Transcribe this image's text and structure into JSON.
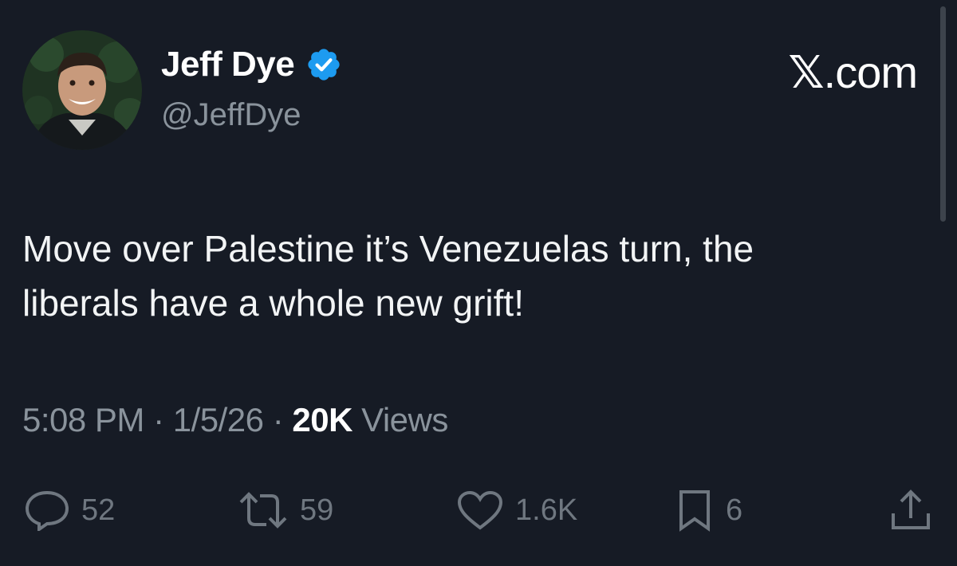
{
  "author": {
    "name": "Jeff Dye",
    "handle": "@JeffDye",
    "verified": true
  },
  "brand": {
    "domain": ".com",
    "logo_glyph": "𝕏"
  },
  "tweet": {
    "text_line1": "Move over Palestine it’s Venezuelas turn, the",
    "text_line2": "liberals have a whole new grift!"
  },
  "meta": {
    "time": "5:08 PM",
    "separator1": " · ",
    "date": "1/5/26",
    "separator2": " · ",
    "views_count": "20K",
    "views_label": " Views"
  },
  "actions": {
    "replies": "52",
    "reposts": "59",
    "likes": "1.6K",
    "bookmarks": "6"
  },
  "colors": {
    "background": "#161b25",
    "verified_blue": "#1d9bf0",
    "muted_text": "#8a939c"
  }
}
